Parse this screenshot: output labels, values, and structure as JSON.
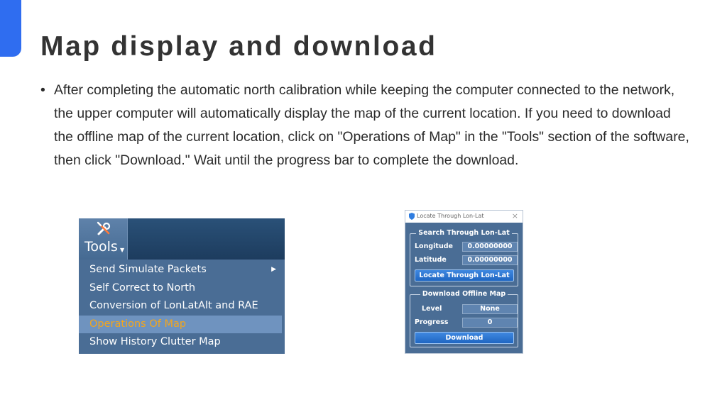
{
  "slide": {
    "title": "Map display and download",
    "bullet_marker": "•",
    "bullet_text": "After completing the automatic north calibration while keeping the computer connected to the network, the upper computer will automatically display the map of the current location. If you need to download the offline map of the current location, click on \"Operations of Map\" in the \"Tools\" section of the software, then click \"Download.\" Wait until the progress bar to complete the download.",
    "accent_color": "#2f6df0"
  },
  "tools_menu": {
    "button_label": "Tools",
    "button_icon": "tools-wrench-screwdriver-icon",
    "items": [
      {
        "label": "Send Simulate Packets",
        "has_submenu": true
      },
      {
        "label": "Self Correct to North",
        "has_submenu": false
      },
      {
        "label": "Conversion of LonLatAlt and RAE",
        "has_submenu": false
      },
      {
        "label": "Operations Of Map",
        "has_submenu": false,
        "highlighted": true
      },
      {
        "label": "Show History Clutter Map",
        "has_submenu": false
      }
    ],
    "highlight_text_color": "#f2a61e"
  },
  "locate_dialog": {
    "title": "Locate Through Lon-Lat",
    "close_glyph": "×",
    "search_group": {
      "title": "Search Through Lon-Lat",
      "longitude_label": "Longitude",
      "longitude_value": "0.00000000",
      "latitude_label": "Latitude",
      "latitude_value": "0.00000000",
      "locate_button": "Locate Through Lon-Lat"
    },
    "download_group": {
      "title": "Download Offline Map",
      "level_label": "Level",
      "level_value": "None",
      "progress_label": "Progress",
      "progress_value": "0",
      "download_button": "Download"
    }
  }
}
